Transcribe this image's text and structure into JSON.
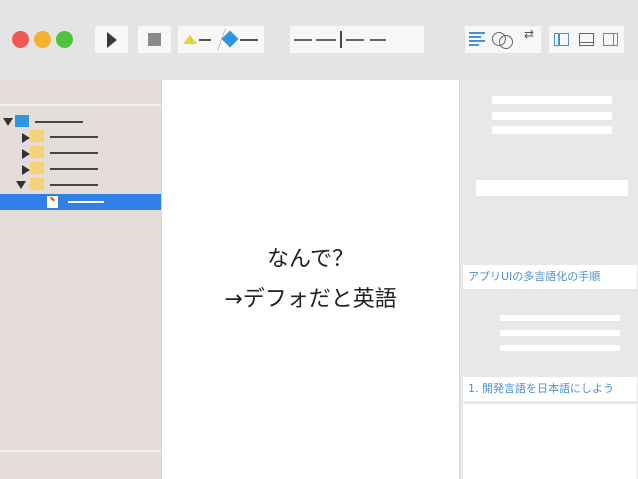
{
  "window": {
    "controls": [
      "close",
      "minimize",
      "zoom"
    ]
  },
  "toolbar": {
    "run_icon": "play-icon",
    "stop_icon": "stop-icon",
    "scheme_icons": [
      "app-target-icon",
      "device-icon"
    ],
    "editor_icons": [
      "standard-editor-icon",
      "assistant-editor-icon",
      "version-editor-icon"
    ],
    "view_icons": [
      "navigator-pane-icon",
      "debug-pane-icon",
      "utilities-pane-icon"
    ]
  },
  "navigator": {
    "colors": {
      "selection": "#2f7fe6",
      "folder": "#f3d573",
      "project": "#2f95e0"
    }
  },
  "editor": {
    "line1": "なんで？",
    "line2": "→デフォだと英語"
  },
  "inspector": {
    "section_title": "アプリUIの多言語化の手順",
    "step1": "1. 開発言語を日本語にしよう",
    "accent_color": "#4a8fd6"
  }
}
